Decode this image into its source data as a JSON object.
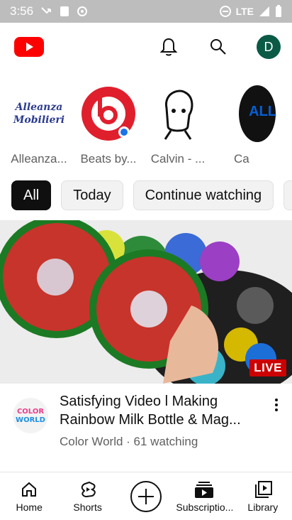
{
  "status_bar": {
    "time": "3:56",
    "network": "LTE"
  },
  "app": {
    "logo": "youtube-logo",
    "avatar_letter": "D"
  },
  "colors": {
    "brand_red": "#ff0000",
    "link_blue": "#065fd4",
    "live_red": "#cc0000",
    "avatar_green": "#0a5a46"
  },
  "channels": {
    "items": [
      {
        "name": "Alleanza...",
        "logo_line1": "Alleanza",
        "logo_line2": "Mobilieri"
      },
      {
        "name": "Beats by..."
      },
      {
        "name": "Calvin - ..."
      },
      {
        "name": "Ca"
      }
    ],
    "all_label": "ALL"
  },
  "chips": [
    {
      "label": "All",
      "active": true
    },
    {
      "label": "Today",
      "active": false
    },
    {
      "label": "Continue watching",
      "active": false
    }
  ],
  "video": {
    "live_label": "LIVE",
    "title": "Satisfying Video l Making Rainbow Milk Bottle & Mag...",
    "subtitle": "Color World · 61 watching",
    "channel_logo_line1": "COLOR",
    "channel_logo_line2": "WORLD"
  },
  "bottom_nav": [
    {
      "label": "Home",
      "icon": "home-icon"
    },
    {
      "label": "Shorts",
      "icon": "shorts-icon"
    },
    {
      "label": "",
      "icon": "create-icon"
    },
    {
      "label": "Subscriptio...",
      "icon": "subscriptions-icon"
    },
    {
      "label": "Library",
      "icon": "library-icon"
    }
  ]
}
